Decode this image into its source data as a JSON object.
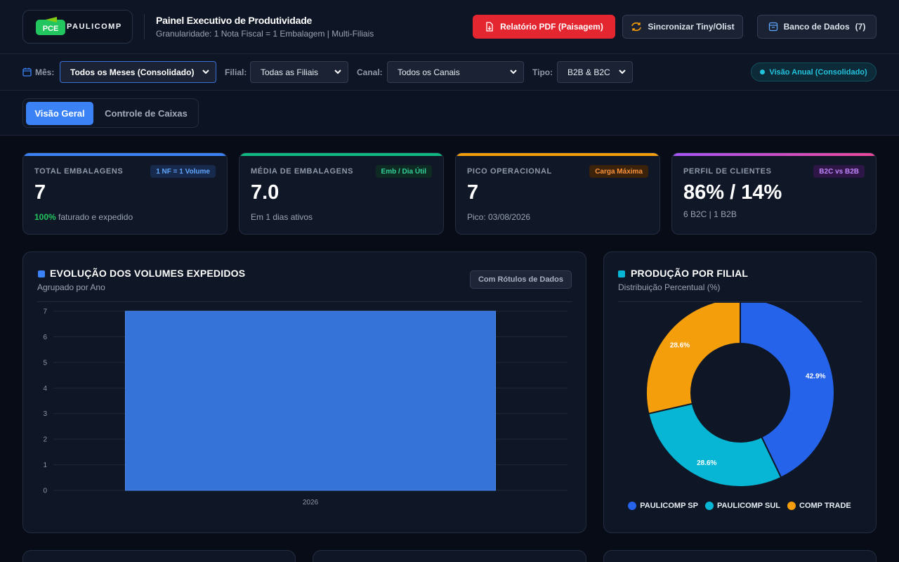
{
  "header": {
    "logo_text": "PAULICOMP",
    "logo_mark_text": "PCE",
    "title": "Painel Executivo de Produtividade",
    "subtitle": "Granularidade: 1 Nota Fiscal = 1 Embalagem | Multi-Filiais",
    "pdf_button": "Relatório PDF (Paisagem)",
    "sync_button": "Sincronizar Tiny/Olist",
    "db_button": "Banco de Dados",
    "db_count": "(7)"
  },
  "filters": {
    "month_label": "Mês:",
    "month_value": "Todos os Meses (Consolidado)",
    "branch_label": "Filial:",
    "branch_value": "Todas as Filiais",
    "channel_label": "Canal:",
    "channel_value": "Todos os Canais",
    "type_label": "Tipo:",
    "type_value": "B2B & B2C",
    "annual_pill": "Visão Anual (Consolidado)"
  },
  "tabs": [
    {
      "label": "Visão Geral",
      "active": true
    },
    {
      "label": "Controle de Caixas",
      "active": false
    }
  ],
  "kpis": [
    {
      "label": "TOTAL EMBALAGENS",
      "badge": "1 NF = 1 Volume",
      "value": "7",
      "foot_strong": "100%",
      "foot": "faturado e expedido",
      "color": "#3b82f6"
    },
    {
      "label": "MÉDIA DE EMBALAGENS",
      "badge": "Emb / Dia Útil",
      "value": "7.0",
      "foot_strong": "",
      "foot": "Em 1 dias ativos",
      "color": "#10b981"
    },
    {
      "label": "PICO OPERACIONAL",
      "badge": "Carga Máxima",
      "value": "7",
      "foot_strong": "",
      "foot": "Pico: 03/08/2026",
      "color": "#f59e0b"
    },
    {
      "label": "PERFIL DE CLIENTES",
      "badge": "B2C vs B2B",
      "value": "86% / 14%",
      "foot_strong": "",
      "foot": "6 B2C | 1 B2B",
      "color": "#a855f7"
    }
  ],
  "volume_panel": {
    "title": "EVOLUÇÃO DOS VOLUMES EXPEDIDOS",
    "subtitle": "Agrupado por Ano",
    "labels_button": "Com Rótulos de Dados"
  },
  "branch_panel": {
    "title": "PRODUÇÃO POR FILIAL",
    "subtitle": "Distribuição Percentual (%)"
  },
  "chart_data": [
    {
      "type": "bar",
      "categories": [
        "2026"
      ],
      "values": [
        7
      ],
      "data_labels": [
        "7"
      ],
      "ylim": [
        0,
        7
      ],
      "yticks": [
        0,
        1,
        2,
        3,
        4,
        5,
        6,
        7
      ],
      "grid": true,
      "color": "#3673d9"
    },
    {
      "type": "pie",
      "donut": true,
      "categories": [
        "PAULICOMP SP",
        "PAULICOMP SUL",
        "COMP TRADE"
      ],
      "values": [
        42.9,
        28.6,
        28.6
      ],
      "data_labels": [
        "42.9%",
        "28.6%",
        "28.6%"
      ],
      "colors": [
        "#2563eb",
        "#06b6d4",
        "#f59e0b"
      ],
      "legend": "bottom"
    }
  ]
}
